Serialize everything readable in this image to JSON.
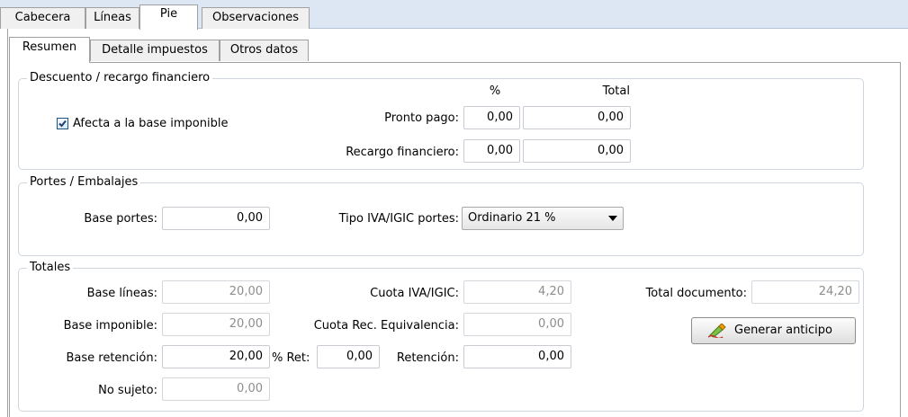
{
  "top_tabs": [
    "Cabecera",
    "Líneas",
    "Pie",
    "Observaciones"
  ],
  "inner_tabs": [
    "Resumen",
    "Detalle impuestos",
    "Otros datos"
  ],
  "descuento": {
    "legend": "Descuento / recargo financiero",
    "afecta_label": "Afecta a la base imponible",
    "afecta_checked": true,
    "col_pct": "%",
    "col_total": "Total",
    "pronto_pago_label": "Pronto pago:",
    "pronto_pago_pct": "0,00",
    "pronto_pago_total": "0,00",
    "recargo_label": "Recargo financiero:",
    "recargo_pct": "0,00",
    "recargo_total": "0,00"
  },
  "portes": {
    "legend": "Portes / Embalajes",
    "base_portes_label": "Base portes:",
    "base_portes_value": "0,00",
    "tipo_iva_label": "Tipo IVA/IGIC portes:",
    "tipo_iva_value": "Ordinario 21 %"
  },
  "totales": {
    "legend": "Totales",
    "base_lineas_label": "Base líneas:",
    "base_lineas_value": "20,00",
    "base_imponible_label": "Base imponible:",
    "base_imponible_value": "20,00",
    "base_retencion_label": "Base retención:",
    "base_retencion_value": "20,00",
    "pct_ret_label": "% Ret:",
    "pct_ret_value": "0,00",
    "no_sujeto_label": "No sujeto:",
    "no_sujeto_value": "0,00",
    "cuota_iva_label": "Cuota IVA/IGIC:",
    "cuota_iva_value": "4,20",
    "cuota_rec_label": "Cuota Rec. Equivalencia:",
    "cuota_rec_value": "0,00",
    "retencion_label": "Retención:",
    "retencion_value": "0,00",
    "total_documento_label": "Total documento:",
    "total_documento_value": "24,20",
    "generar_anticipo_label": "Generar anticipo"
  }
}
